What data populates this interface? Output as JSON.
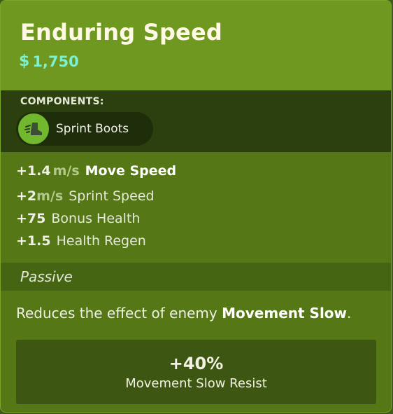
{
  "item": {
    "title": "Enduring Speed",
    "cost_symbol": "$",
    "cost": "1,750",
    "components_label": "COMPONENTS:",
    "components": [
      {
        "name": "Sprint Boots",
        "icon": "boot-icon"
      }
    ],
    "stats": [
      {
        "plus": "+",
        "value": "1.4",
        "unit": "m/s",
        "label": "Move Speed"
      },
      {
        "plus": "+",
        "value": "2",
        "unit": "m/s",
        "label": "Sprint Speed"
      },
      {
        "plus": "+",
        "value": "75",
        "unit": "",
        "label": "Bonus Health"
      },
      {
        "plus": "+",
        "value": "1.5",
        "unit": "",
        "label": "Health Regen"
      }
    ],
    "passive": {
      "title": "Passive",
      "desc_prefix": "Reduces the effect of enemy ",
      "desc_highlight": "Movement Slow",
      "desc_suffix": ".",
      "resist_value": "+40%",
      "resist_label": "Movement Slow Resist"
    }
  },
  "colors": {
    "card_bg": "#6c961f",
    "components_bg": "#2c3f0f",
    "stats_bg": "#557716",
    "cost": "#7df0cf",
    "component_icon_bg": "#72b82e"
  }
}
